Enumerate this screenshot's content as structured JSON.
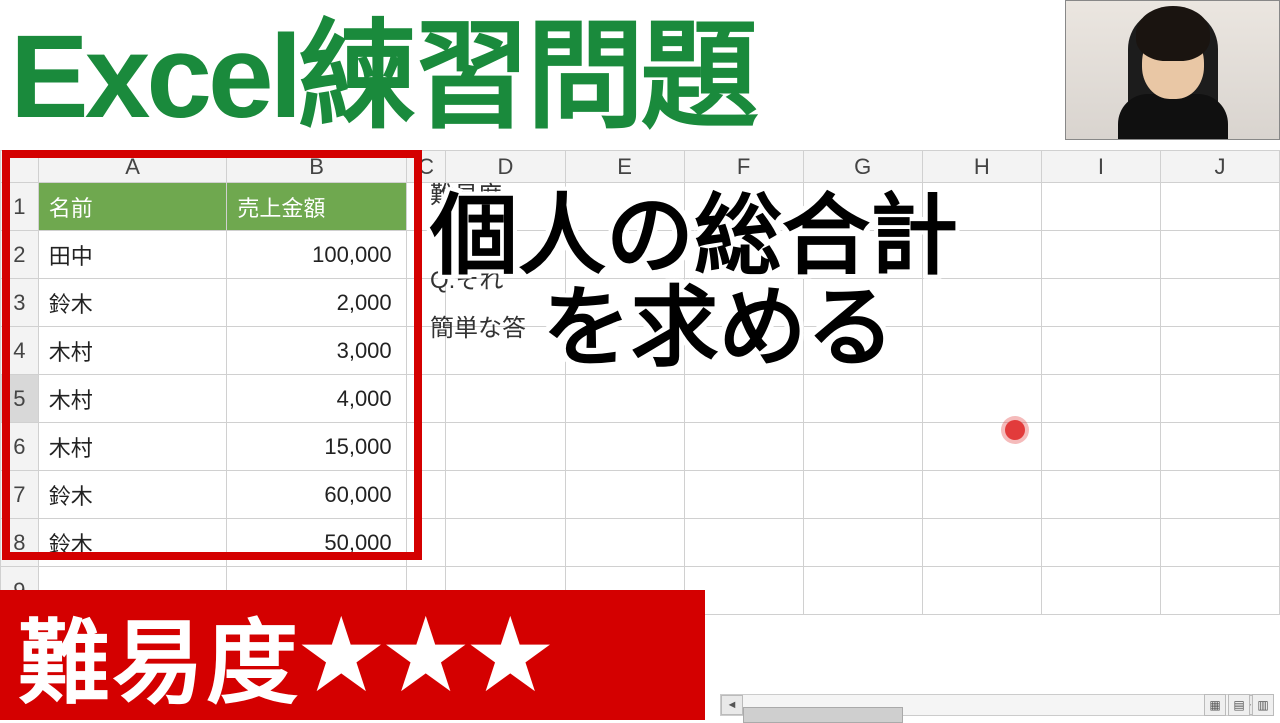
{
  "title": "Excel練習問題",
  "subtitle_line1": "個人の総合計",
  "subtitle_line2": "を求める",
  "difficulty_label": "難易度",
  "difficulty_stars": "★★★",
  "columns": [
    "A",
    "B",
    "C",
    "D",
    "E",
    "F",
    "G",
    "H",
    "I",
    "J"
  ],
  "selected_row": 5,
  "table": {
    "headers": {
      "a": "名前",
      "b": "売上金額"
    },
    "rows": [
      {
        "a": "田中",
        "b": "100,000"
      },
      {
        "a": "鈴木",
        "b": "2,000"
      },
      {
        "a": "木村",
        "b": "3,000"
      },
      {
        "a": "木村",
        "b": "4,000"
      },
      {
        "a": "木村",
        "b": "15,000"
      },
      {
        "a": "鈴木",
        "b": "60,000"
      },
      {
        "a": "鈴木",
        "b": "50,000"
      }
    ]
  },
  "bg_text": {
    "difficulty": "難易度",
    "question": "Q.それ",
    "answer": "簡単な答"
  },
  "chart_data": {
    "type": "table",
    "title": "売上金額",
    "columns": [
      "名前",
      "売上金額"
    ],
    "rows": [
      [
        "田中",
        100000
      ],
      [
        "鈴木",
        2000
      ],
      [
        "木村",
        3000
      ],
      [
        "木村",
        4000
      ],
      [
        "木村",
        15000
      ],
      [
        "鈴木",
        60000
      ],
      [
        "鈴木",
        50000
      ]
    ]
  }
}
